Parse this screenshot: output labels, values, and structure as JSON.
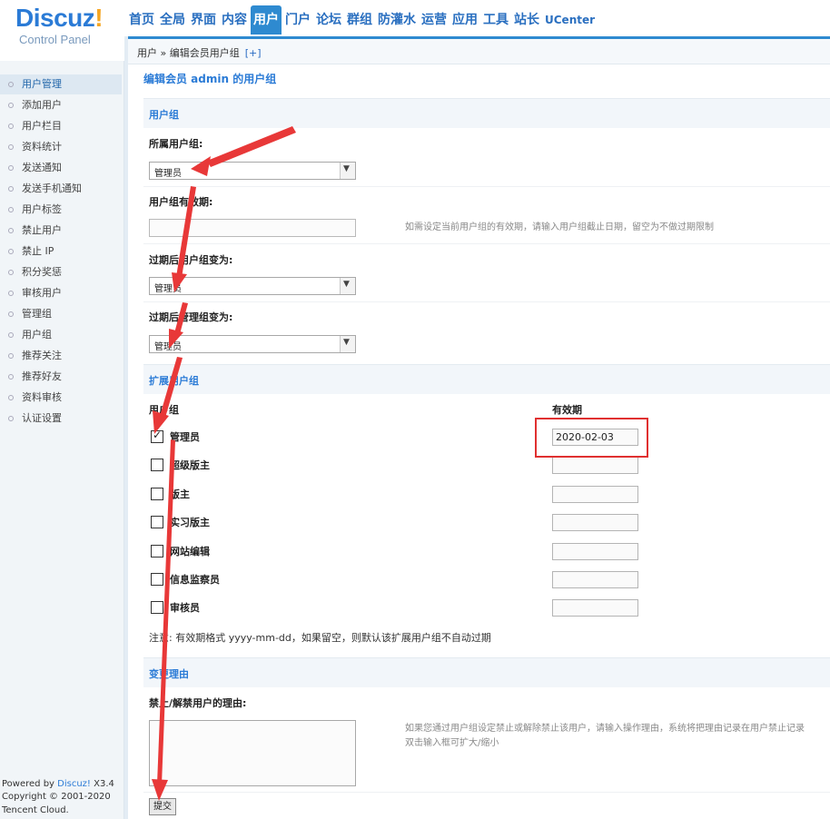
{
  "header": {
    "logo_text": "Discuz",
    "logo_bang": "!",
    "logo_sub": "Control Panel",
    "nav": [
      {
        "label": "首页",
        "active": false
      },
      {
        "label": "全局",
        "active": false
      },
      {
        "label": "界面",
        "active": false
      },
      {
        "label": "内容",
        "active": false
      },
      {
        "label": "用户",
        "active": true
      },
      {
        "label": "门户",
        "active": false
      },
      {
        "label": "论坛",
        "active": false
      },
      {
        "label": "群组",
        "active": false
      },
      {
        "label": "防灌水",
        "active": false
      },
      {
        "label": "运营",
        "active": false
      },
      {
        "label": "应用",
        "active": false
      },
      {
        "label": "工具",
        "active": false
      },
      {
        "label": "站长",
        "active": false
      },
      {
        "label": "UCenter",
        "active": false
      }
    ]
  },
  "sidebar": {
    "items": [
      {
        "label": "用户管理",
        "active": true
      },
      {
        "label": "添加用户"
      },
      {
        "label": "用户栏目"
      },
      {
        "label": "资料统计"
      },
      {
        "label": "发送通知"
      },
      {
        "label": "发送手机通知"
      },
      {
        "label": "用户标签"
      },
      {
        "label": "禁止用户"
      },
      {
        "label": "禁止 IP"
      },
      {
        "label": "积分奖惩"
      },
      {
        "label": "审核用户"
      },
      {
        "label": "管理组"
      },
      {
        "label": "用户组"
      },
      {
        "label": "推荐关注"
      },
      {
        "label": "推荐好友"
      },
      {
        "label": "资料审核"
      },
      {
        "label": "认证设置"
      }
    ],
    "footer": {
      "powered_prefix": "Powered by ",
      "powered_brand": "Discuz!",
      "version": " X3.4",
      "copyright": "Copyright © 2001-2020",
      "company": "Tencent Cloud."
    }
  },
  "breadcrumb": {
    "text": "用户 » 编辑会员用户组",
    "plus": "[+]"
  },
  "page_title": "编辑会员 admin 的用户组",
  "section_usergroup": {
    "title": "用户组",
    "group_label": "所属用户组:",
    "group_value": "管理员",
    "expiry_label": "用户组有效期:",
    "expiry_value": "",
    "expiry_hint": "如需设定当前用户组的有效期，请输入用户组截止日期，留空为不做过期限制",
    "after_group_label": "过期后用户组变为:",
    "after_group_value": "管理员",
    "after_admin_label": "过期后管理组变为:",
    "after_admin_value": "管理员"
  },
  "section_extended": {
    "title": "扩展用户组",
    "col_group": "用户组",
    "col_expiry": "有效期",
    "rows": [
      {
        "label": "管理员",
        "checked": true,
        "date": "2020-02-03"
      },
      {
        "label": "超级版主",
        "checked": false,
        "date": ""
      },
      {
        "label": "版主",
        "checked": false,
        "date": ""
      },
      {
        "label": "实习版主",
        "checked": false,
        "date": ""
      },
      {
        "label": "网站编辑",
        "checked": false,
        "date": ""
      },
      {
        "label": "信息监察员",
        "checked": false,
        "date": ""
      },
      {
        "label": "审核员",
        "checked": false,
        "date": ""
      }
    ],
    "note": "注意: 有效期格式 yyyy-mm-dd，如果留空，则默认该扩展用户组不自动过期"
  },
  "section_reason": {
    "title": "变更理由",
    "label": "禁止/解禁用户的理由:",
    "hint_line1": "如果您通过用户组设定禁止或解除禁止该用户，请输入操作理由，系统将把理由记录在用户禁止记录",
    "hint_line2": "双击输入框可扩大/缩小"
  },
  "submit_label": "提交",
  "colors": {
    "accent": "#2b7bd6",
    "annotation": "#e03030"
  }
}
